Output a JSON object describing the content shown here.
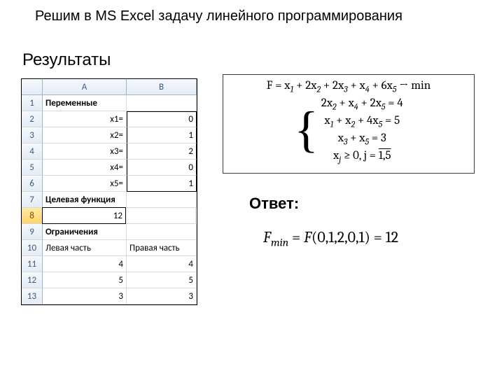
{
  "title": "Решим в MS Excel задачу линейного программирования",
  "results_label": "Результаты",
  "excel": {
    "col_headers": {
      "A": "A",
      "B": "B"
    },
    "rows": [
      {
        "n": "1",
        "A": "Переменные",
        "B": ""
      },
      {
        "n": "2",
        "A": "x1=",
        "B": "0"
      },
      {
        "n": "3",
        "A": "x2=",
        "B": "1"
      },
      {
        "n": "4",
        "A": "x3=",
        "B": "2"
      },
      {
        "n": "5",
        "A": "x4=",
        "B": "0"
      },
      {
        "n": "6",
        "A": "x5=",
        "B": "1"
      },
      {
        "n": "7",
        "A": "Целевая функция",
        "B": ""
      },
      {
        "n": "8",
        "A": "12",
        "B": ""
      },
      {
        "n": "9",
        "A": "Ограничения",
        "B": ""
      },
      {
        "n": "10",
        "A": "Левая часть",
        "B": "Правая часть"
      },
      {
        "n": "11",
        "A": "4",
        "B": "4"
      },
      {
        "n": "12",
        "A": "5",
        "B": "5"
      },
      {
        "n": "13",
        "A": "3",
        "B": "3"
      }
    ]
  },
  "formula": {
    "objective_html": "F = x<sub>1</sub> + 2x<sub>2</sub> + 2x<sub>3</sub> + x<sub>4</sub> + 6x<sub>5</sub> → min",
    "c1_html": "2x<sub>2</sub> + x<sub>4</sub> + 2x<sub>5</sub> = 4",
    "c2_html": "x<sub>1</sub> + x<sub>2</sub> + 4x<sub>5</sub> = 5",
    "c3_html": "x<sub>3</sub> + x<sub>5</sub> = 3",
    "c4_html": "x<sub>j</sub> ≥ 0, j = <span class=\"over\">1,5</span>"
  },
  "answer_label": "Ответ:",
  "answer_html": "F<sub>min</sub> <span class=\"paren\">=</span> F<span class=\"paren\">(0,1,2,0,1) = 12</span>"
}
